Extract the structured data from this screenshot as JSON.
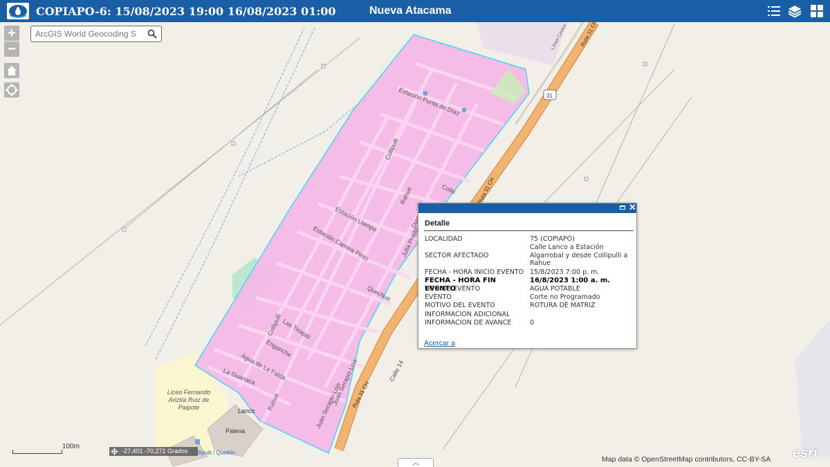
{
  "header": {
    "title": "COPIAPO-6: 15/08/2023 19:00 16/08/2023 01:00",
    "subtitle": "Nueva Atacama",
    "icons": [
      "logo-icon",
      "legend-list-icon",
      "layers-icon",
      "basemap-gallery-icon"
    ]
  },
  "map_controls": {
    "zoom_in": "+",
    "zoom_out": "−",
    "home": "home-icon",
    "locate": "locate-icon"
  },
  "search": {
    "placeholder": "ArcGIS World Geocoding S",
    "icon": "search-icon"
  },
  "map_labels": {
    "ruta_31_ch_1": "Ruta 31 CH",
    "ruta_31_ch_2": "Ruta 31 CH",
    "ruta_31_ch_3": "Ruta 31 CH",
    "route_shield": "31",
    "linea_central": "Línea Centra",
    "estacion_punta_de_diaz": "Estación Punta de Díaz",
    "collipulli_1": "Collipulli",
    "collipulli_2": "Collipulli",
    "collipulli_3": "Collipulli",
    "rahue_1": "Rahue",
    "rahue_2": "Rahue",
    "diaguitas": "Diaguitas",
    "collo": "Collo",
    "estacion_llampo": "Estación Llampo",
    "estacion_carrera_pinto": "Estación Carrera Pinto",
    "julia_prado": "Julia Prado",
    "quechua": "Quechua",
    "las_tinajas": "Las Tinajas",
    "enganche": "Enganche",
    "agua_de_la_falda": "Agua de La Falda",
    "la_guanaca": "La Guanaca",
    "juan_serapio_lois_1": "Juan Serapio Lois",
    "juan_serapio_lois_2": "Juan Serapio Lois",
    "calle_14": "Calle 14",
    "lanco": "Lanco",
    "palena": "Palena",
    "liceo": "Liceo Fernando Ariztía Ruiz de Paipote",
    "collipulli_quellon": "Collipulli / Quellón"
  },
  "popup": {
    "title": "Detalle",
    "attributes": [
      {
        "label": "LOCALIDAD",
        "value": "75 (COPIAPÓ)",
        "bold": false
      },
      {
        "label": "SECTOR AFECTADO",
        "value": "Calle Lanco a Estación Algarrobal y desde Collipulli a Rahue",
        "bold": false
      },
      {
        "label": "FECHA - HORA INICIO EVENTO",
        "value": "15/8/2023 7:00 p. m.",
        "bold": false
      },
      {
        "label": "FECHA - HORA FIN EVENTO",
        "value": "16/8/2023 1:00 a. m.",
        "bold": true
      },
      {
        "label": "TIPO DE EVENTO",
        "value": "AGUA POTABLE",
        "bold": false
      },
      {
        "label": "EVENTO",
        "value": "Corte no Programado",
        "bold": false
      },
      {
        "label": "MOTIVO DEL EVENTO",
        "value": "ROTURA DE MATRIZ",
        "bold": false
      },
      {
        "label": "INFORMACION ADICIONAL",
        "value": "",
        "bold": false
      },
      {
        "label": "INFORMACION DE AVANCE",
        "value": "0",
        "bold": false
      }
    ],
    "zoom_link": "Acercar a"
  },
  "footer": {
    "scale": "100m",
    "coordinates": "-27,401 -70,271 Grados",
    "attribution": "Map data © OpenStreetMap contributors, CC-BY-SA",
    "esri_logo": "esri"
  },
  "colors": {
    "header": "#1a5ea5",
    "affected_area_fill": "#f5b8e6",
    "affected_area_outline": "#37d7ee",
    "highway": "#f4b471"
  }
}
